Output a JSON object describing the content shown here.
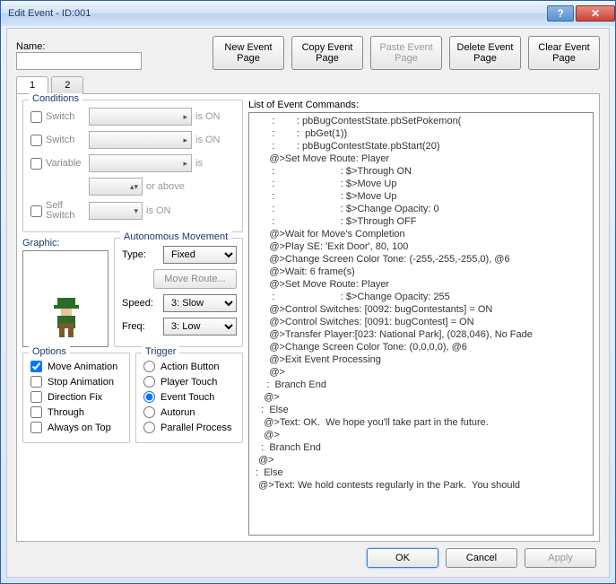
{
  "window": {
    "title": "Edit Event - ID:001"
  },
  "nameLabel": "Name:",
  "nameValue": "",
  "topButtons": {
    "new": "New\nEvent Page",
    "copy": "Copy\nEvent Page",
    "paste": "Paste\nEvent Page",
    "delete": "Delete\nEvent Page",
    "clear": "Clear\nEvent Page"
  },
  "tabs": {
    "t1": "1",
    "t2": "2"
  },
  "conditions": {
    "legend": "Conditions",
    "switch": "Switch",
    "variable": "Variable",
    "selfSwitch": "Self\nSwitch",
    "isOn": "is ON",
    "is": "is",
    "orAbove": "or above"
  },
  "graphic": {
    "legend": "Graphic:"
  },
  "automove": {
    "legend": "Autonomous Movement",
    "typeLabel": "Type:",
    "typeValue": "Fixed",
    "moveRoute": "Move Route...",
    "speedLabel": "Speed:",
    "speedValue": "3: Slow",
    "freqLabel": "Freq:",
    "freqValue": "3: Low"
  },
  "options": {
    "legend": "Options",
    "moveAnim": "Move Animation",
    "stopAnim": "Stop Animation",
    "dirFix": "Direction Fix",
    "through": "Through",
    "alwaysTop": "Always on Top"
  },
  "trigger": {
    "legend": "Trigger",
    "action": "Action Button",
    "player": "Player Touch",
    "event": "Event Touch",
    "autorun": "Autorun",
    "parallel": "Parallel Process"
  },
  "listLabel": "List of Event Commands:",
  "cmds": [
    {
      "cls": "c-gray",
      "text": "       :        : pbBugContestState.pbSetPokemon("
    },
    {
      "cls": "c-gray",
      "text": "       :        :  pbGet(1))"
    },
    {
      "cls": "c-gray",
      "text": "       :        : pbBugContestState.pbStart(20)"
    },
    {
      "cls": "c-green",
      "text": "      @>Set Move Route: Player"
    },
    {
      "cls": "c-red",
      "text": "       :                        : $>Through ON"
    },
    {
      "cls": "c-red",
      "text": "       :                        : $>Move Up"
    },
    {
      "cls": "c-red",
      "text": "       :                        : $>Move Up"
    },
    {
      "cls": "c-red",
      "text": "       :                        : $>Change Opacity: 0"
    },
    {
      "cls": "c-red",
      "text": "       :                        : $>Through OFF"
    },
    {
      "cls": "c-gray",
      "text": "      @>Wait for Move's Completion"
    },
    {
      "cls": "c-teal",
      "text": "      @>Play SE: 'Exit Door', 80, 100"
    },
    {
      "cls": "c-olive",
      "text": "      @>Change Screen Color Tone: (-255,-255,-255,0), @6"
    },
    {
      "cls": "c-gray",
      "text": "      @>Wait: 6 frame(s)"
    },
    {
      "cls": "c-green",
      "text": "      @>Set Move Route: Player"
    },
    {
      "cls": "c-red",
      "text": "       :                        : $>Change Opacity: 255"
    },
    {
      "cls": "c-red",
      "text": "      @>Control Switches: [0092: bugContestants] = ON"
    },
    {
      "cls": "c-red",
      "text": "      @>Control Switches: [0091: bugContest] = ON"
    },
    {
      "cls": "c-olive",
      "text": "      @>Transfer Player:[023: National Park], (028,046), No Fade"
    },
    {
      "cls": "c-olive",
      "text": "      @>Change Screen Color Tone: (0,0,0,0), @6"
    },
    {
      "cls": "c-blue",
      "text": "      @>Exit Event Processing"
    },
    {
      "cls": "c-gray",
      "text": "      @>"
    },
    {
      "cls": "c-blue",
      "text": "     :  Branch End"
    },
    {
      "cls": "c-gray",
      "text": "    @>"
    },
    {
      "cls": "c-blue",
      "text": "   :  Else"
    },
    {
      "cls": "c-gray",
      "text": "    @>Text: OK.  We hope you'll take part in the future."
    },
    {
      "cls": "c-gray",
      "text": "    @>"
    },
    {
      "cls": "c-blue",
      "text": "   :  Branch End"
    },
    {
      "cls": "c-gray",
      "text": "  @>"
    },
    {
      "cls": "c-blue",
      "text": " :  Else"
    },
    {
      "cls": "c-gray",
      "text": "  @>Text: We hold contests regularly in the Park.  You should"
    }
  ],
  "dlg": {
    "ok": "OK",
    "cancel": "Cancel",
    "apply": "Apply"
  }
}
